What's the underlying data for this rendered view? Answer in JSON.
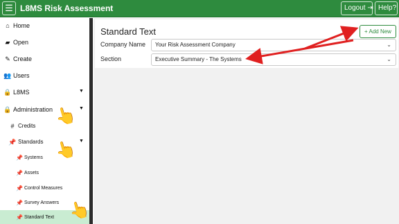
{
  "header": {
    "menu_icon": "hamburger-icon",
    "title": "L8MS Risk Assessment",
    "logout_label": "Logout",
    "help_label": "Help"
  },
  "sidebar": {
    "items": [
      {
        "label": "Home",
        "icon": "home-icon"
      },
      {
        "label": "Open",
        "icon": "folder-open-icon"
      },
      {
        "label": "Create",
        "icon": "edit-icon"
      },
      {
        "label": "Users",
        "icon": "users-icon"
      },
      {
        "label": "L8MS",
        "icon": "lock-icon"
      },
      {
        "label": "Administration",
        "icon": "lock-icon"
      },
      {
        "label": "Credits",
        "icon": "hash-icon"
      },
      {
        "label": "Standards",
        "icon": "pin-icon"
      },
      {
        "label": "Systems",
        "icon": "pin-icon"
      },
      {
        "label": "Assets",
        "icon": "pin-icon"
      },
      {
        "label": "Control Measures",
        "icon": "pin-icon"
      },
      {
        "label": "Survey Answers",
        "icon": "pin-icon"
      },
      {
        "label": "Standard Text",
        "icon": "pin-icon",
        "active": true
      }
    ]
  },
  "main": {
    "title": "Standard Text",
    "add_new_label": "Add New",
    "fields": {
      "company_label": "Company Name",
      "company_value": "Your Risk Assessment Company",
      "section_label": "Section",
      "section_value": "Executive Summary - The Systems"
    }
  },
  "colors": {
    "header_green": "#2e8b3e",
    "active_item": "#c9ecd2",
    "annotation_arrow": "#e02020"
  }
}
